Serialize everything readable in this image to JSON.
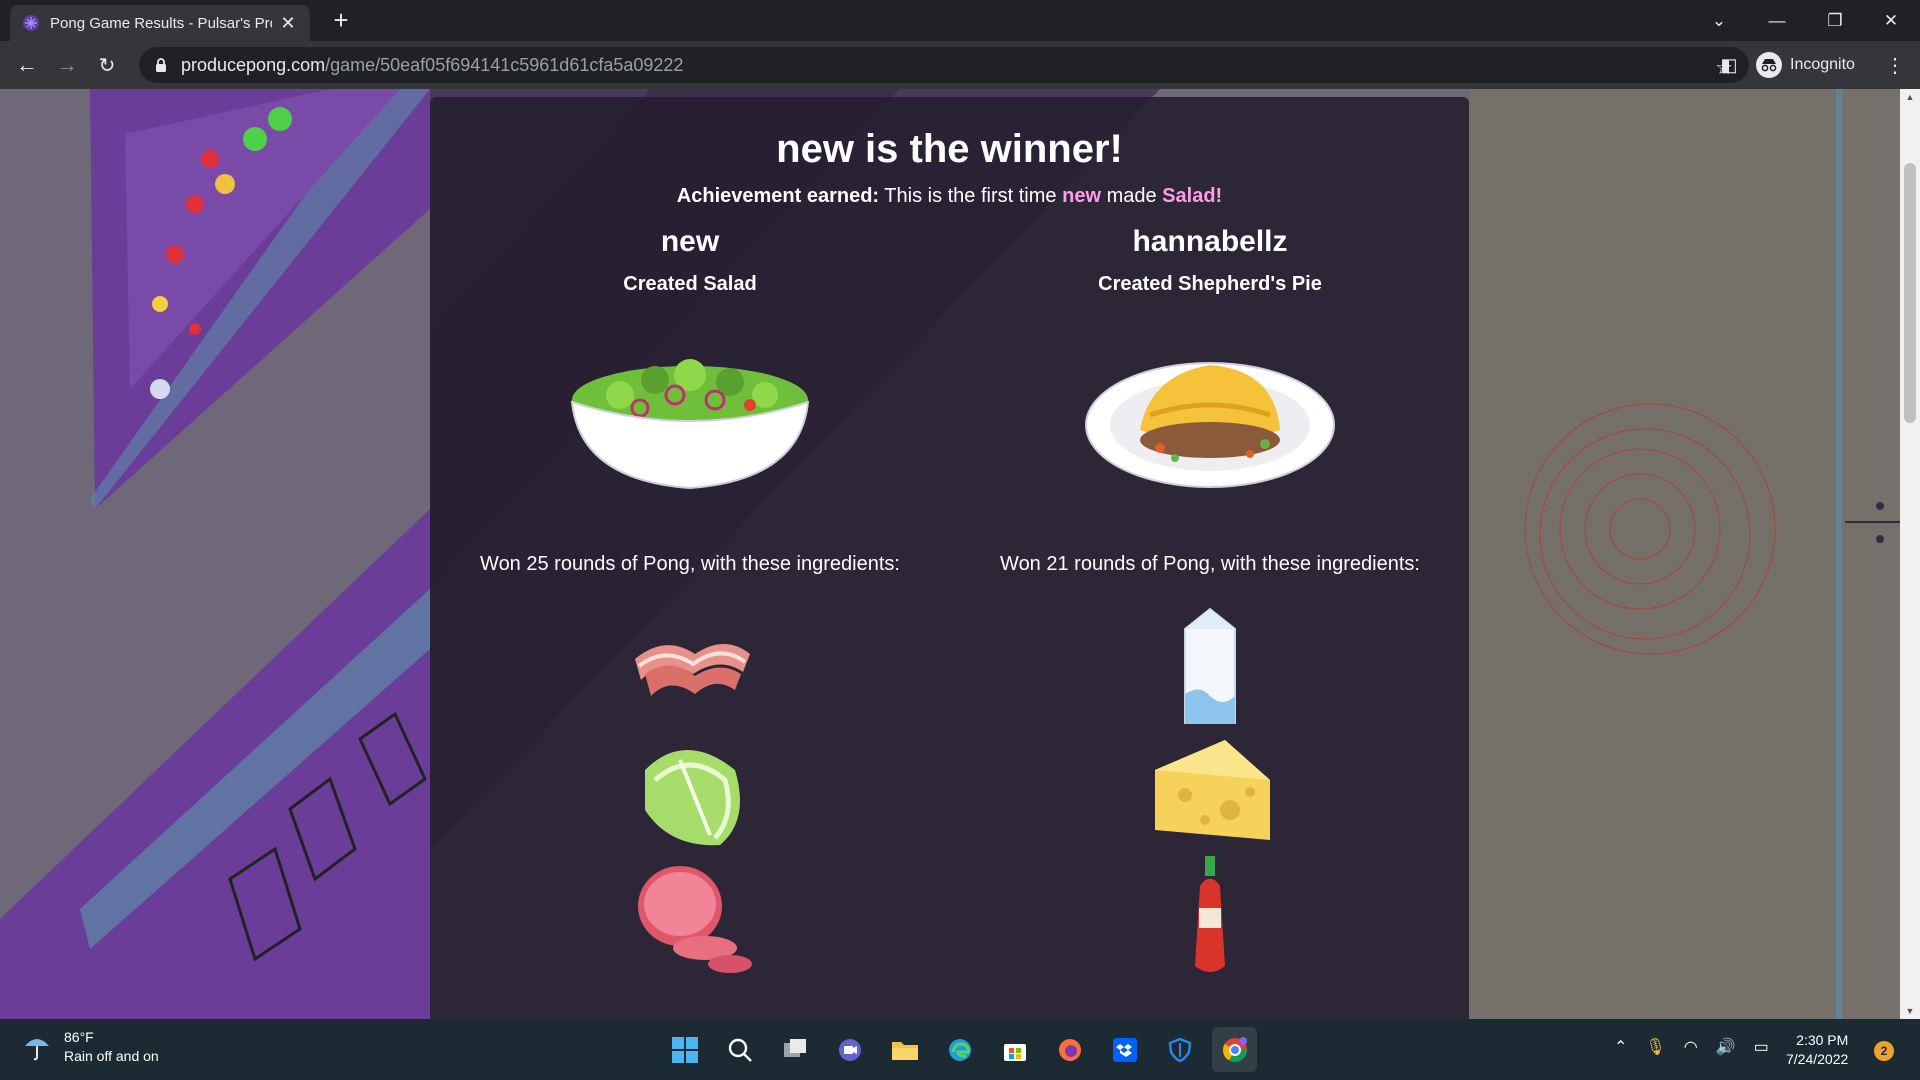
{
  "browser": {
    "tab_title": "Pong Game Results - Pulsar's Pro",
    "url_host": "producepong.com",
    "url_path": "/game/50eaf05f694141c5961d61cfa5a09222",
    "incognito_label": "Incognito"
  },
  "page": {
    "winner_heading": "new is the winner!",
    "achievement": {
      "label": "Achievement earned:",
      "text_before": "This is the first time",
      "player": "new",
      "text_middle": "made",
      "dish": "Salad",
      "text_after": "!"
    },
    "players": [
      {
        "name": "new",
        "created": "Created Salad",
        "dish_icon": "salad-bowl-icon",
        "rounds_text": "Won 25 rounds of Pong, with these ingredients:",
        "ingredients": [
          "bacon-icon",
          "lettuce-icon",
          "ham-icon"
        ]
      },
      {
        "name": "hannabellz",
        "created": "Created Shepherd's Pie",
        "dish_icon": "shepherds-pie-icon",
        "rounds_text": "Won 21 rounds of Pong, with these ingredients:",
        "ingredients": [
          "milk-carton-icon",
          "cheese-icon",
          "hot-sauce-icon"
        ]
      }
    ],
    "highlight_color": "#ff9ce8"
  },
  "taskbar": {
    "temperature": "86°F",
    "weather_text": "Rain off and on",
    "time": "2:30 PM",
    "date": "7/24/2022",
    "notification_count": "2"
  }
}
